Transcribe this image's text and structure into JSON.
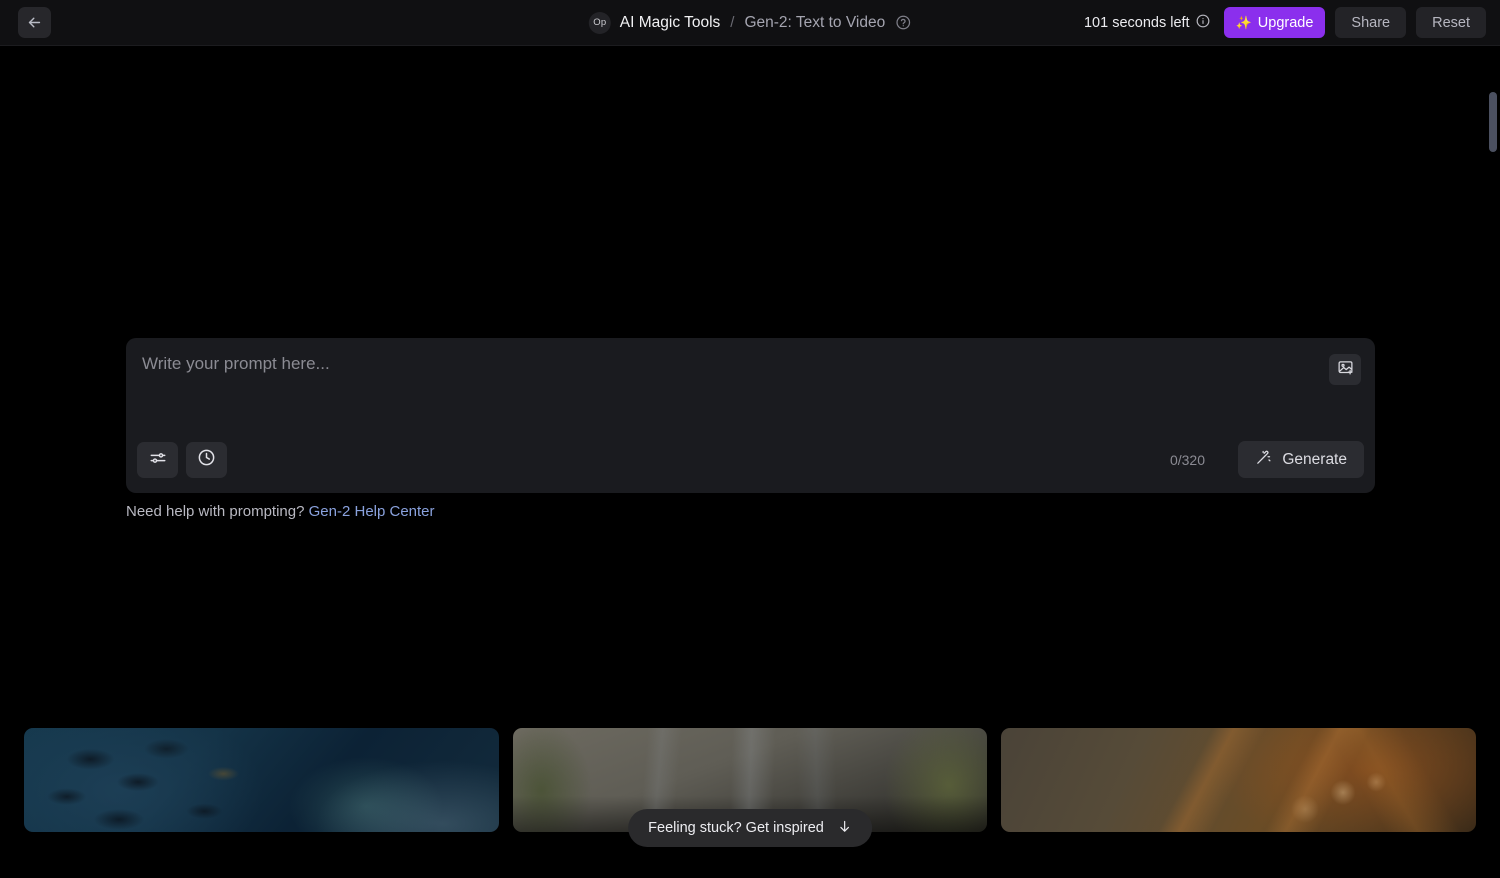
{
  "header": {
    "back_label": "Back",
    "back_icon": "arrow-left-icon",
    "avatar_initials": "Op",
    "breadcrumb_root": "AI Magic Tools",
    "breadcrumb_separator": "/",
    "breadcrumb_current": "Gen-2: Text to Video",
    "help_icon": "question-circle-icon",
    "seconds_left": "101 seconds left",
    "info_icon": "info-circle-icon",
    "upgrade_label": "Upgrade",
    "upgrade_icon": "sparkles-icon",
    "upgrade_color": "#8b2fed",
    "share_label": "Share",
    "reset_label": "Reset"
  },
  "prompt": {
    "placeholder": "Write your prompt here...",
    "value": "",
    "image_upload_icon": "image-plus-icon",
    "settings_icon": "sliders-icon",
    "history_icon": "clock-icon",
    "char_count": "0/320",
    "generate_label": "Generate",
    "generate_icon": "magic-wand-icon"
  },
  "help": {
    "text": "Need help with prompting?",
    "link_label": "Gen-2 Help Center",
    "link_color": "#8aa2de"
  },
  "inspire": {
    "label": "Feeling stuck? Get inspired",
    "icon": "arrow-down-icon"
  },
  "thumbnails": [
    {
      "name": "underwater-fish-scene"
    },
    {
      "name": "city-skyline-trees-scene"
    },
    {
      "name": "autumn-leaves-bokeh-scene"
    }
  ],
  "scrollbar": {
    "thumb_color": "#4b5060"
  }
}
